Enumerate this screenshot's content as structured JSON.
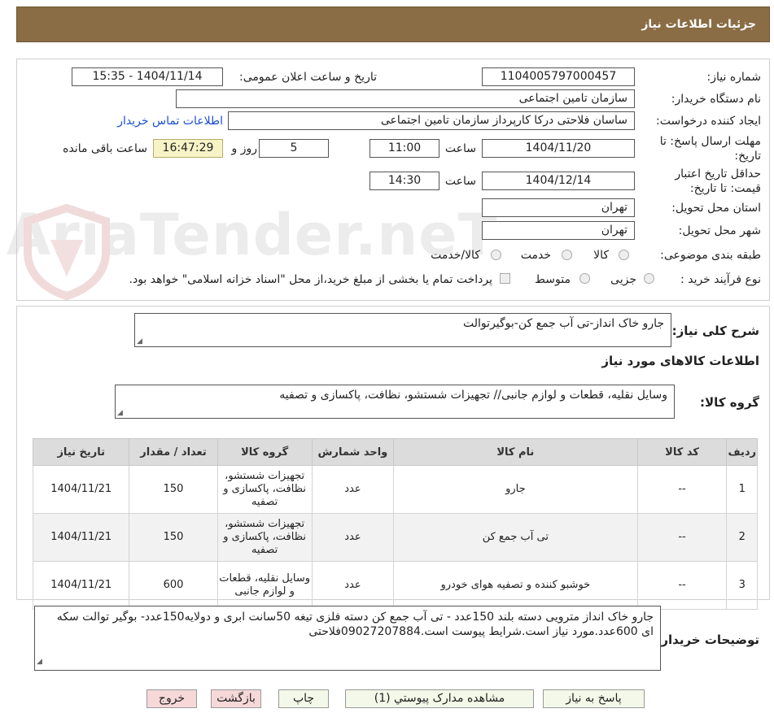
{
  "header": {
    "title": "جزئیات اطلاعات نیاز"
  },
  "watermark": {
    "text": "AriaTender.neT"
  },
  "form": {
    "need_number_label": "شماره نیاز:",
    "need_number": "1104005797000457",
    "announce_label": "تاریخ و ساعت اعلان عمومی:",
    "announce_value": "1404/11/14 - 15:35",
    "buyer_org_label": "نام دستگاه خریدار:",
    "buyer_org": "سازمان تامین اجتماعی",
    "creator_label": "ایجاد کننده درخواست:",
    "creator": "ساسان فلاحتی درکا کارپرداز سازمان تامین اجتماعی",
    "contact_link": "اطلاعات تماس خریدار",
    "deadline_label": "مهلت ارسال پاسخ: تا تاریخ:",
    "deadline_date": "1404/11/20",
    "time_label": "ساعت",
    "deadline_time": "11:00",
    "days": "5",
    "days_label": "روز و",
    "remaining_time": "16:47:29",
    "remaining_label": "ساعت باقی مانده",
    "validity_label": "حداقل تاریخ اعتبار قیمت: تا تاریخ:",
    "validity_date": "1404/12/14",
    "validity_time": "14:30",
    "province_label": "استان محل تحویل:",
    "province": "تهران",
    "city_label": "شهر محل تحویل:",
    "city": "تهران",
    "category_label": "طبقه بندی موضوعی:",
    "category_options": [
      "کالا",
      "خدمت",
      "کالا/خدمت"
    ],
    "process_label": "نوع فرآیند خرید :",
    "process_options": [
      "جزیی",
      "متوسط"
    ],
    "payment_note": "پرداخت تمام یا بخشی از مبلغ خرید،از محل \"اسناد خزانه اسلامی\" خواهد بود."
  },
  "summary": {
    "label": "شرح کلی نیاز:",
    "value": "جارو خاک انداز-تی آب جمع کن-بوگیرتوالت"
  },
  "goods_section_title": "اطلاعات کالاهای مورد نیاز",
  "goods_group": {
    "label": "گروه کالا:",
    "value": "وسایل نقلیه، قطعات و لوازم جانبی// تجهیزات شستشو، نظافت، پاکسازی و تصفیه"
  },
  "table": {
    "headers": [
      "ردیف",
      "کد کالا",
      "نام کالا",
      "واحد شمارش",
      "گروه کالا",
      "تعداد / مقدار",
      "تاریخ نیاز"
    ],
    "rows": [
      [
        "1",
        "--",
        "جارو",
        "عدد",
        "تجهیزات شستشو، نظافت، پاکسازی و تصفیه",
        "150",
        "1404/11/21"
      ],
      [
        "2",
        "--",
        "تی آب جمع کن",
        "عدد",
        "تجهیزات شستشو، نظافت، پاکسازی و تصفیه",
        "150",
        "1404/11/21"
      ],
      [
        "3",
        "--",
        "خوشبو کننده و تصفیه هوای خودرو",
        "عدد",
        "وسایل نقلیه، قطعات و لوازم جانبی",
        "600",
        "1404/11/21"
      ]
    ]
  },
  "buyer_notes": {
    "label": "توضیحات خریدار:",
    "value": "جارو خاک انداز مترویی دسته بلند 150عدد - تی آب جمع کن دسته فلزی تیغه 50سانت ابری و دولایه150عدد- بوگیر توالت سکه ای 600عدد.مورد نیاز است.شرایط پیوست است.09027207884فلاحتی"
  },
  "buttons": {
    "reply": "پاسخ به نیاز",
    "attachments": "مشاهده مدارک پیوستي (1)",
    "print": "چاپ",
    "back": "بازگشت",
    "exit": "خروج"
  }
}
